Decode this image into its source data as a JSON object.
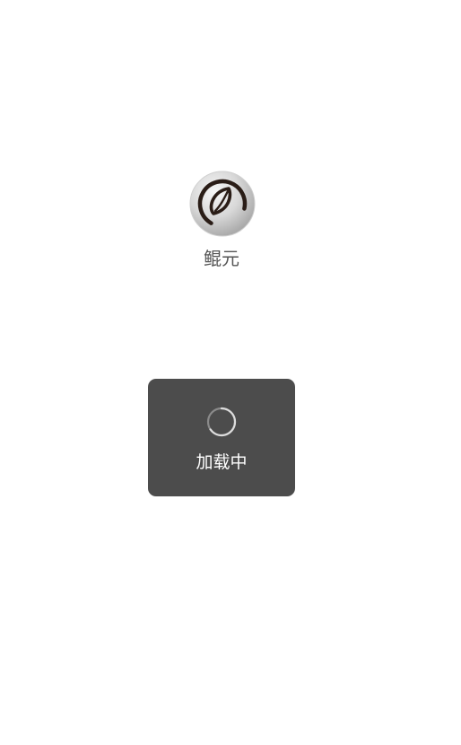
{
  "app": {
    "name": "鲲元",
    "logo_icon": "coffee-bean-leaf-icon"
  },
  "loading": {
    "text": "加载中",
    "spinner_icon": "loading-spinner-icon"
  },
  "colors": {
    "background": "#ffffff",
    "toast_background": "#4c4c4c",
    "toast_text": "#ffffff",
    "app_name_text": "#555555"
  }
}
